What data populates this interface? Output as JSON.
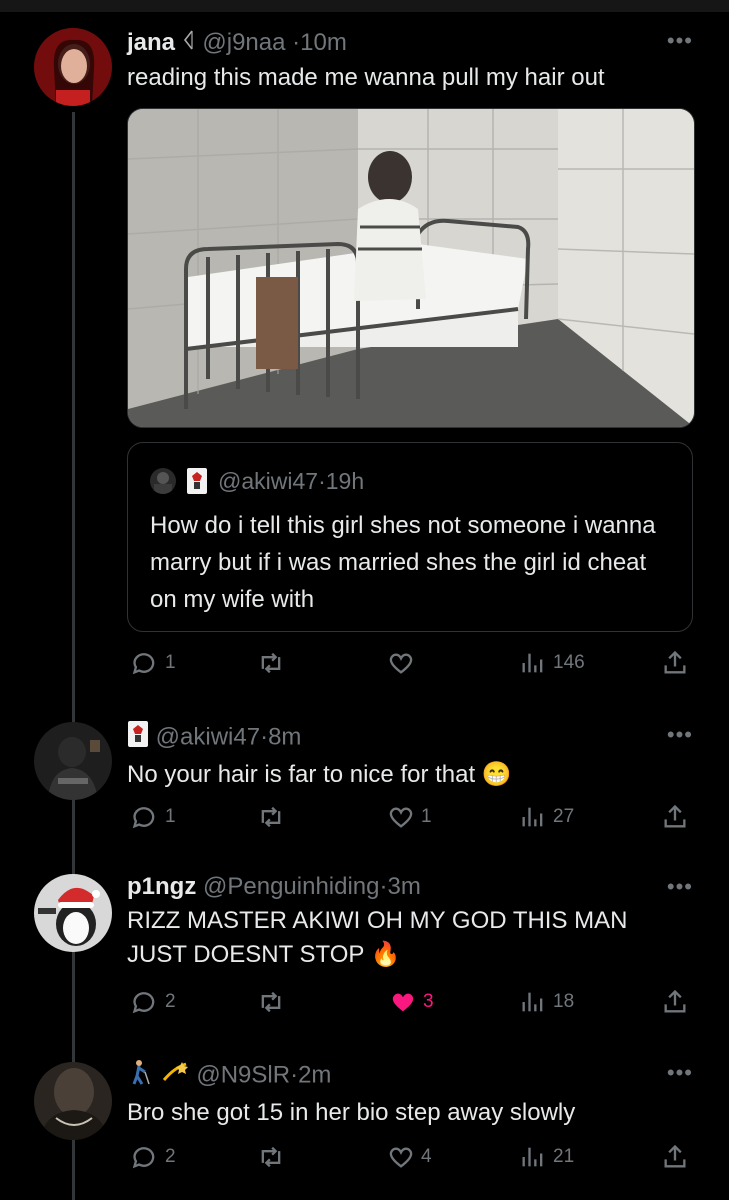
{
  "posts": [
    {
      "name": "jana",
      "handle": "@j9naa",
      "time": "10m",
      "text": "reading this made me wanna pull my hair out",
      "quote": {
        "handle": "@akiwi47",
        "time": "19h",
        "text": "How do i tell this girl shes not someone i wanna marry but if i was married shes the girl id cheat on my wife with"
      },
      "replies": "1",
      "retweets": "",
      "likes": "",
      "views": "146"
    },
    {
      "name": "",
      "handle": "@akiwi47",
      "time": "8m",
      "text": "No your hair is far to nice for that",
      "emoji": "😁",
      "replies": "1",
      "retweets": "",
      "likes": "1",
      "views": "27"
    },
    {
      "name": "p1ngz",
      "handle": "@Penguinhiding",
      "time": "3m",
      "text": "RIZZ MASTER AKIWI OH MY GOD THIS MAN JUST DOESNT STOP",
      "emoji": "🔥",
      "replies": "2",
      "retweets": "",
      "likes": "3",
      "liked": true,
      "views": "18"
    },
    {
      "name": "",
      "handle": "@N9SlR",
      "time": "2m",
      "text": "Bro she got 15 in her bio step away slowly",
      "replies": "2",
      "retweets": "",
      "likes": "4",
      "views": "21"
    }
  ],
  "ui": {
    "separator": "·",
    "more": "•••"
  },
  "colors": {
    "like_active": "#f91880",
    "muted": "#71767b",
    "border": "#2f3336"
  }
}
